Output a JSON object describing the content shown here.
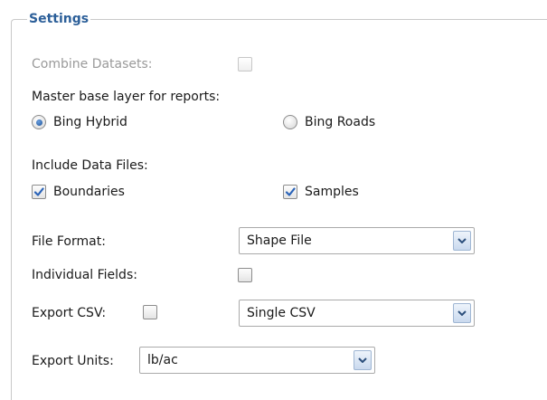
{
  "settings": {
    "legend": "Settings",
    "combine_datasets": {
      "label": "Combine Datasets:",
      "checked": false,
      "disabled": true
    },
    "master_base_layer": {
      "label": "Master base layer for reports:",
      "options": [
        {
          "label": "Bing Hybrid",
          "selected": true
        },
        {
          "label": "Bing Roads",
          "selected": false
        }
      ]
    },
    "include_data_files": {
      "label": "Include Data Files:",
      "boundaries": {
        "label": "Boundaries",
        "checked": true
      },
      "samples": {
        "label": "Samples",
        "checked": true
      }
    },
    "file_format": {
      "label": "File Format:",
      "value": "Shape File"
    },
    "individual_fields": {
      "label": "Individual Fields:",
      "checked": false
    },
    "export_csv": {
      "label": "Export CSV:",
      "checked": false,
      "value": "Single CSV"
    },
    "export_units": {
      "label": "Export Units:",
      "value": "lb/ac"
    },
    "colors": {
      "accent": "#2c5f99",
      "check": "#2a63b8",
      "border": "#c9c9c9"
    },
    "icons": {
      "dropdown": "chevron-down-icon",
      "check": "check-icon"
    }
  }
}
